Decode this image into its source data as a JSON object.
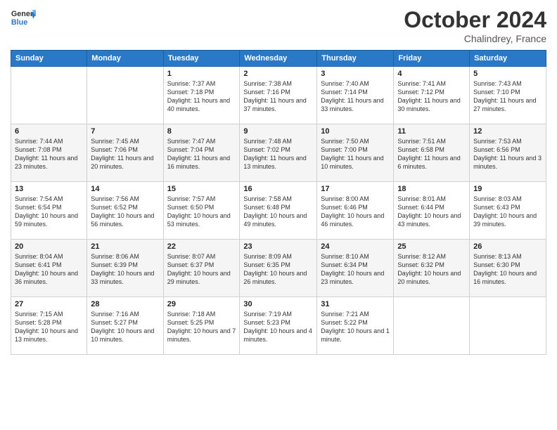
{
  "header": {
    "logo_general": "General",
    "logo_blue": "Blue",
    "month_title": "October 2024",
    "location": "Chalindrey, France"
  },
  "days_of_week": [
    "Sunday",
    "Monday",
    "Tuesday",
    "Wednesday",
    "Thursday",
    "Friday",
    "Saturday"
  ],
  "weeks": [
    [
      {
        "day": "",
        "info": ""
      },
      {
        "day": "",
        "info": ""
      },
      {
        "day": "1",
        "info": "Sunrise: 7:37 AM\nSunset: 7:18 PM\nDaylight: 11 hours and 40 minutes."
      },
      {
        "day": "2",
        "info": "Sunrise: 7:38 AM\nSunset: 7:16 PM\nDaylight: 11 hours and 37 minutes."
      },
      {
        "day": "3",
        "info": "Sunrise: 7:40 AM\nSunset: 7:14 PM\nDaylight: 11 hours and 33 minutes."
      },
      {
        "day": "4",
        "info": "Sunrise: 7:41 AM\nSunset: 7:12 PM\nDaylight: 11 hours and 30 minutes."
      },
      {
        "day": "5",
        "info": "Sunrise: 7:43 AM\nSunset: 7:10 PM\nDaylight: 11 hours and 27 minutes."
      }
    ],
    [
      {
        "day": "6",
        "info": "Sunrise: 7:44 AM\nSunset: 7:08 PM\nDaylight: 11 hours and 23 minutes."
      },
      {
        "day": "7",
        "info": "Sunrise: 7:45 AM\nSunset: 7:06 PM\nDaylight: 11 hours and 20 minutes."
      },
      {
        "day": "8",
        "info": "Sunrise: 7:47 AM\nSunset: 7:04 PM\nDaylight: 11 hours and 16 minutes."
      },
      {
        "day": "9",
        "info": "Sunrise: 7:48 AM\nSunset: 7:02 PM\nDaylight: 11 hours and 13 minutes."
      },
      {
        "day": "10",
        "info": "Sunrise: 7:50 AM\nSunset: 7:00 PM\nDaylight: 11 hours and 10 minutes."
      },
      {
        "day": "11",
        "info": "Sunrise: 7:51 AM\nSunset: 6:58 PM\nDaylight: 11 hours and 6 minutes."
      },
      {
        "day": "12",
        "info": "Sunrise: 7:53 AM\nSunset: 6:56 PM\nDaylight: 11 hours and 3 minutes."
      }
    ],
    [
      {
        "day": "13",
        "info": "Sunrise: 7:54 AM\nSunset: 6:54 PM\nDaylight: 10 hours and 59 minutes."
      },
      {
        "day": "14",
        "info": "Sunrise: 7:56 AM\nSunset: 6:52 PM\nDaylight: 10 hours and 56 minutes."
      },
      {
        "day": "15",
        "info": "Sunrise: 7:57 AM\nSunset: 6:50 PM\nDaylight: 10 hours and 53 minutes."
      },
      {
        "day": "16",
        "info": "Sunrise: 7:58 AM\nSunset: 6:48 PM\nDaylight: 10 hours and 49 minutes."
      },
      {
        "day": "17",
        "info": "Sunrise: 8:00 AM\nSunset: 6:46 PM\nDaylight: 10 hours and 46 minutes."
      },
      {
        "day": "18",
        "info": "Sunrise: 8:01 AM\nSunset: 6:44 PM\nDaylight: 10 hours and 43 minutes."
      },
      {
        "day": "19",
        "info": "Sunrise: 8:03 AM\nSunset: 6:43 PM\nDaylight: 10 hours and 39 minutes."
      }
    ],
    [
      {
        "day": "20",
        "info": "Sunrise: 8:04 AM\nSunset: 6:41 PM\nDaylight: 10 hours and 36 minutes."
      },
      {
        "day": "21",
        "info": "Sunrise: 8:06 AM\nSunset: 6:39 PM\nDaylight: 10 hours and 33 minutes."
      },
      {
        "day": "22",
        "info": "Sunrise: 8:07 AM\nSunset: 6:37 PM\nDaylight: 10 hours and 29 minutes."
      },
      {
        "day": "23",
        "info": "Sunrise: 8:09 AM\nSunset: 6:35 PM\nDaylight: 10 hours and 26 minutes."
      },
      {
        "day": "24",
        "info": "Sunrise: 8:10 AM\nSunset: 6:34 PM\nDaylight: 10 hours and 23 minutes."
      },
      {
        "day": "25",
        "info": "Sunrise: 8:12 AM\nSunset: 6:32 PM\nDaylight: 10 hours and 20 minutes."
      },
      {
        "day": "26",
        "info": "Sunrise: 8:13 AM\nSunset: 6:30 PM\nDaylight: 10 hours and 16 minutes."
      }
    ],
    [
      {
        "day": "27",
        "info": "Sunrise: 7:15 AM\nSunset: 5:28 PM\nDaylight: 10 hours and 13 minutes."
      },
      {
        "day": "28",
        "info": "Sunrise: 7:16 AM\nSunset: 5:27 PM\nDaylight: 10 hours and 10 minutes."
      },
      {
        "day": "29",
        "info": "Sunrise: 7:18 AM\nSunset: 5:25 PM\nDaylight: 10 hours and 7 minutes."
      },
      {
        "day": "30",
        "info": "Sunrise: 7:19 AM\nSunset: 5:23 PM\nDaylight: 10 hours and 4 minutes."
      },
      {
        "day": "31",
        "info": "Sunrise: 7:21 AM\nSunset: 5:22 PM\nDaylight: 10 hours and 1 minute."
      },
      {
        "day": "",
        "info": ""
      },
      {
        "day": "",
        "info": ""
      }
    ]
  ]
}
